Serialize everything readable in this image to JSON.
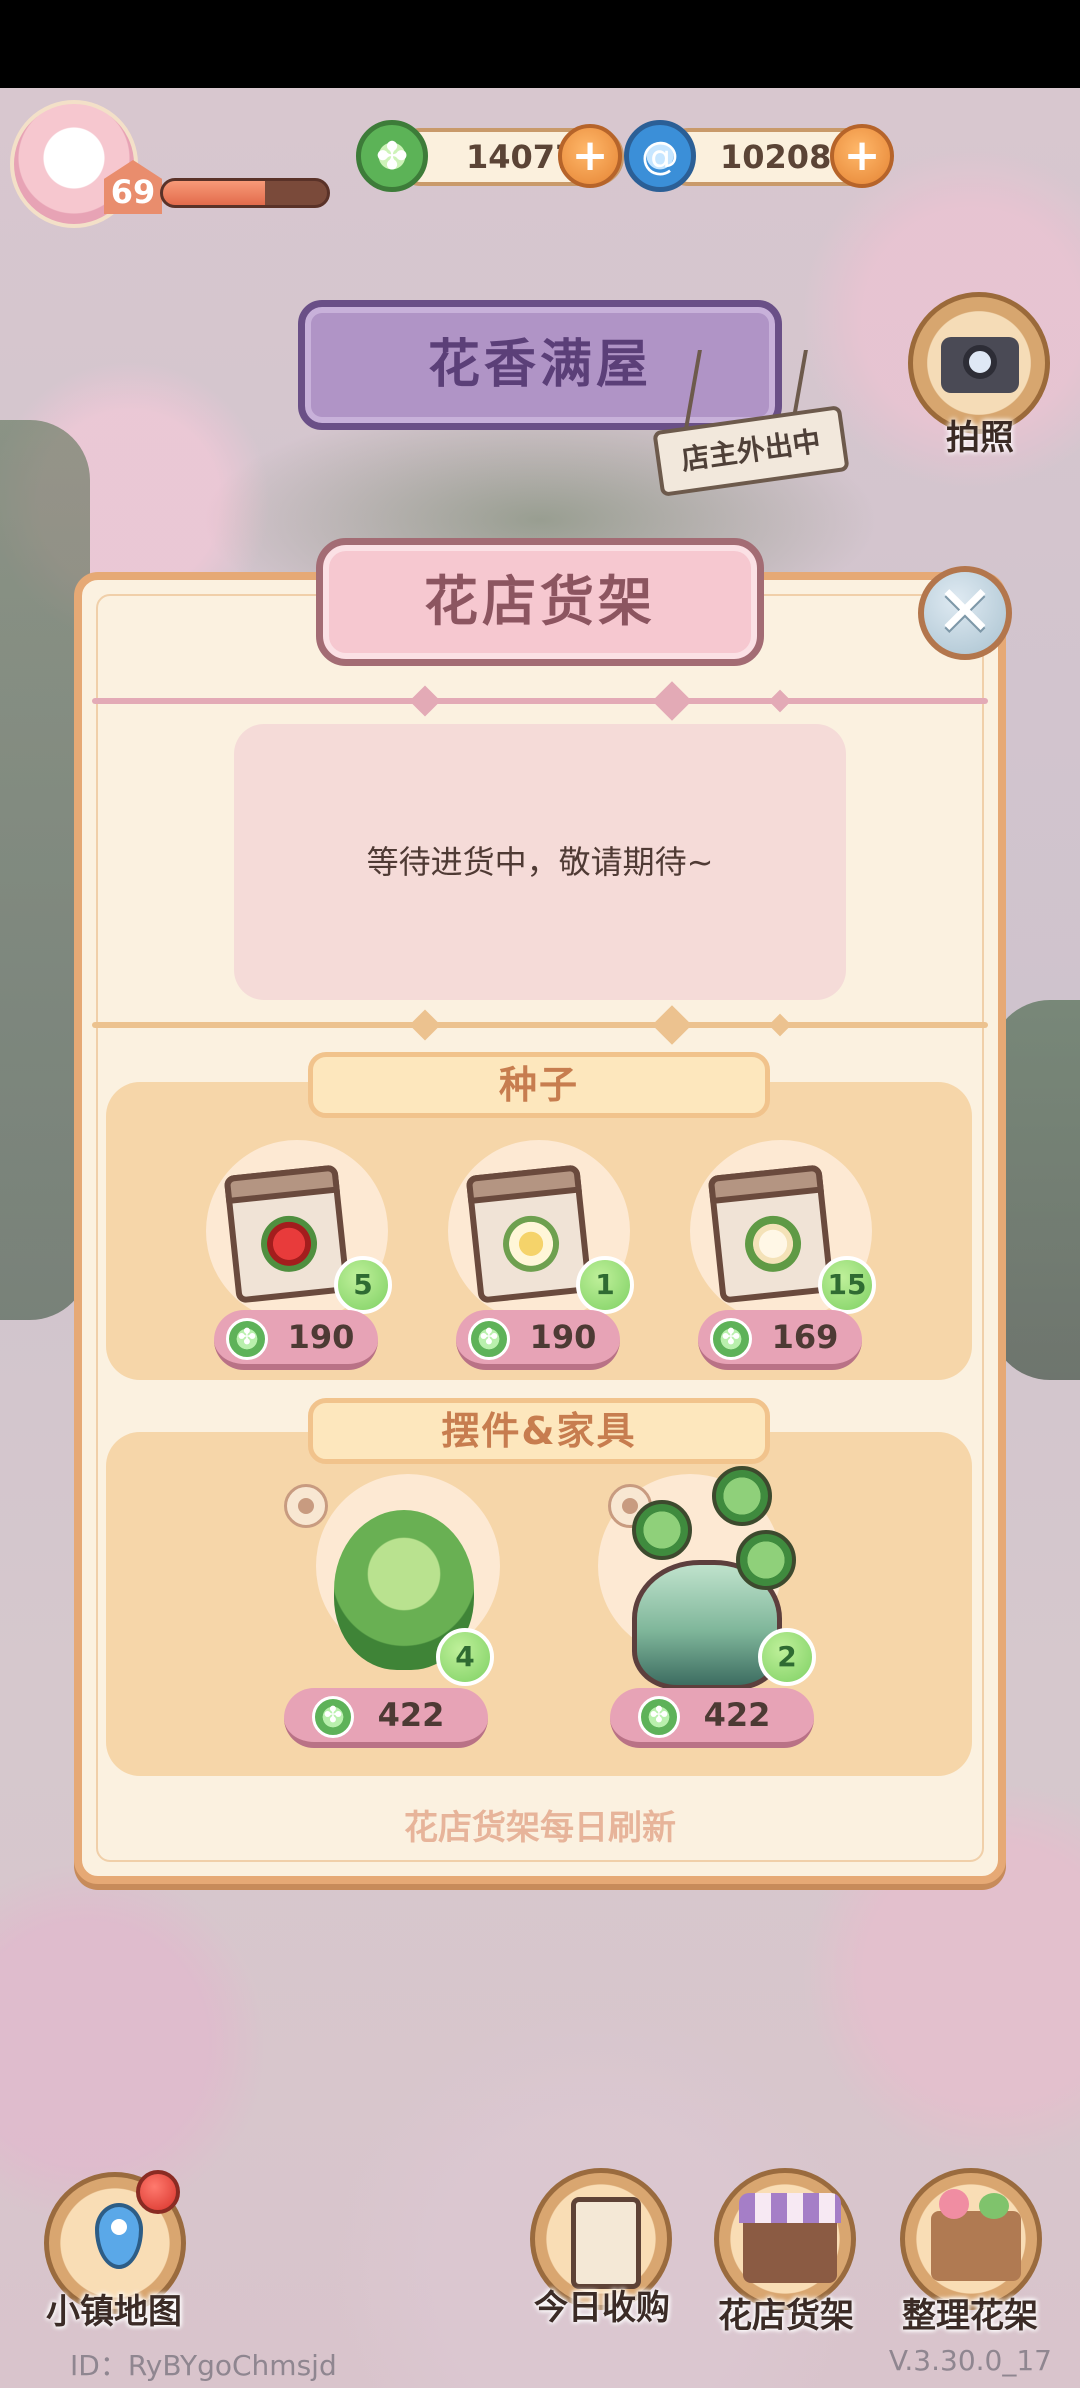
{
  "hud": {
    "level": "69",
    "xp_progress": 0.62,
    "currencies": [
      {
        "name": "clover-coin",
        "value": "14077"
      },
      {
        "name": "swirl-gem",
        "value": "10208"
      }
    ],
    "camera_label": "拍照"
  },
  "scene": {
    "shop_name": "花香满屋",
    "owner_status": "店主外出中"
  },
  "panel": {
    "title": "花店货架",
    "notice": "等待进货中，敬请期待~",
    "sections": {
      "seeds": {
        "title": "种子",
        "items": [
          {
            "name": "red-flower-seed",
            "count": "5",
            "price": "190"
          },
          {
            "name": "yellow-flower-seed",
            "count": "1",
            "price": "190"
          },
          {
            "name": "calla-lily-seed",
            "count": "15",
            "price": "169"
          }
        ]
      },
      "decor": {
        "title": "摆件&家具",
        "items": [
          {
            "name": "hanging-plant",
            "count": "4",
            "price": "422"
          },
          {
            "name": "vase-clover-plant",
            "count": "2",
            "price": "422"
          }
        ]
      }
    },
    "footer": "花店货架每日刷新"
  },
  "bottom_nav": {
    "map": "小镇地图",
    "today_purchase": "今日收购",
    "flower_shelf": "花店货架",
    "arrange_shelf": "整理花架"
  },
  "meta": {
    "id_text": "ID：RyBYgoChmsjd",
    "version": "V.3.30.0_17"
  },
  "colors": {
    "panel_bg": "#fbf1e0",
    "panel_border": "#e6a975",
    "price_pill": "#e7a3b6",
    "count_badge": "#7ed063",
    "plus_button": "#e58434"
  }
}
